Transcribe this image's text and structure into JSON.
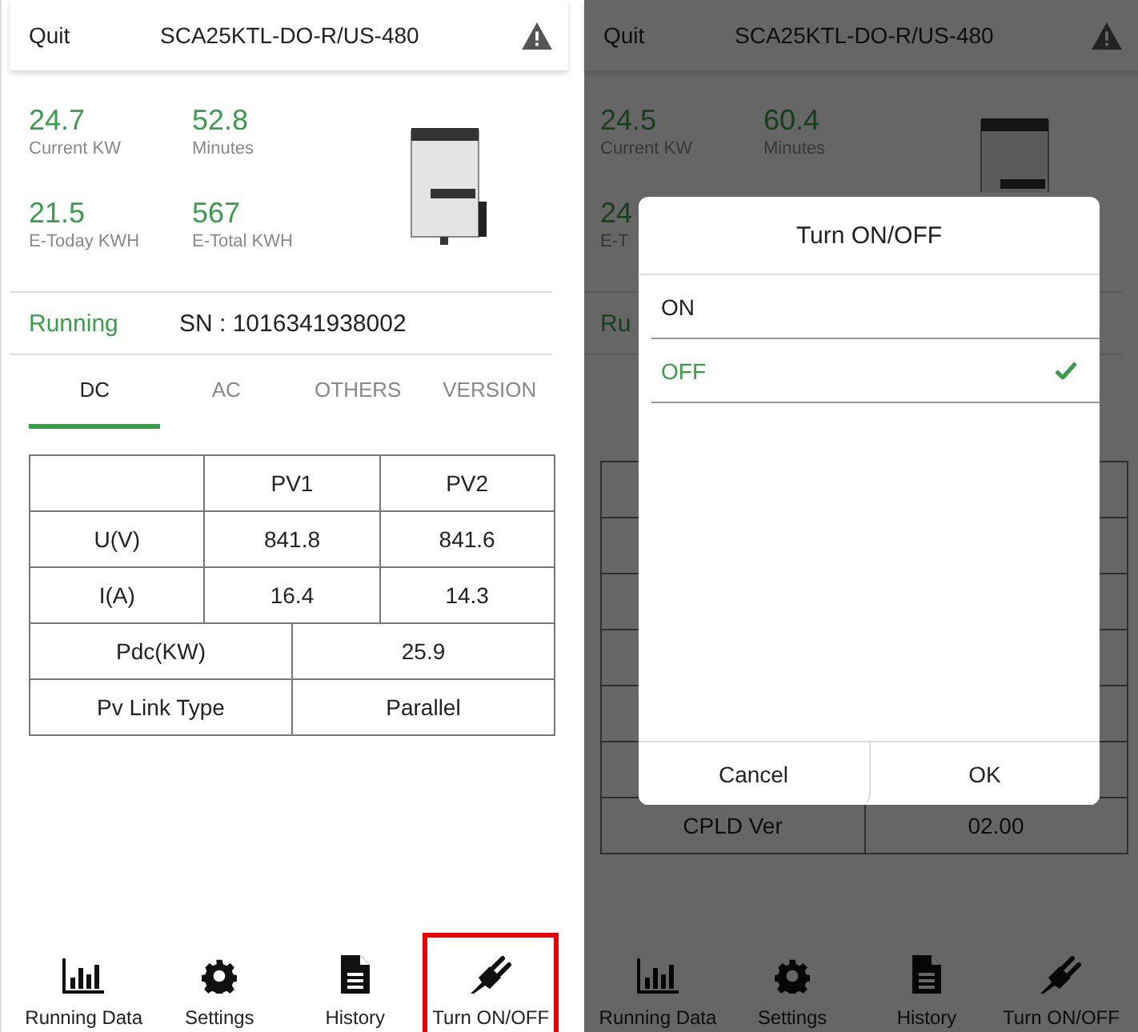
{
  "screens": [
    {
      "header": {
        "quit": "Quit",
        "title": "SCA25KTL-DO-R/US-480"
      },
      "stats": [
        {
          "value": "24.7",
          "label": "Current KW"
        },
        {
          "value": "52.8",
          "label": "Minutes"
        },
        {
          "value": "21.5",
          "label": "E-Today KWH"
        },
        {
          "value": "567",
          "label": "E-Total KWH"
        }
      ],
      "status": "Running",
      "sn": "SN : 1016341938002",
      "tabs": [
        {
          "label": "DC",
          "selected": true
        },
        {
          "label": "AC",
          "selected": false
        },
        {
          "label": "OTHERS",
          "selected": false
        },
        {
          "label": "VERSION",
          "selected": false
        }
      ],
      "table": {
        "header": [
          "PV1",
          "PV2"
        ],
        "rows": [
          {
            "cells": [
              "U(V)",
              "841.8",
              "841.6"
            ]
          },
          {
            "cells": [
              "I(A)",
              "16.4",
              "14.3"
            ]
          },
          {
            "cells": [
              "Pdc(KW)",
              "25.9"
            ]
          },
          {
            "cells": [
              "Pv Link Type",
              "Parallel"
            ]
          }
        ]
      },
      "nav": [
        {
          "kind": "chart",
          "label": "Running Data",
          "highlighted": false
        },
        {
          "kind": "gear",
          "label": "Settings",
          "highlighted": false
        },
        {
          "kind": "document",
          "label": "History",
          "highlighted": false
        },
        {
          "kind": "plug",
          "label": "Turn ON/OFF",
          "highlighted": true
        }
      ]
    },
    {
      "header": {
        "quit": "Quit",
        "title": "SCA25KTL-DO-R/US-480"
      },
      "stats": [
        {
          "value": "24.5",
          "label": "Current KW"
        },
        {
          "value": "60.4",
          "label": "Minutes"
        },
        {
          "value": "24",
          "label": "E-T"
        }
      ],
      "status": "Ru",
      "table": {
        "rows": [
          {
            "cells": [
              "CPLD Ver",
              "02.00"
            ]
          }
        ]
      },
      "nav": [
        {
          "kind": "chart",
          "label": "Running Data",
          "highlighted": false
        },
        {
          "kind": "gear",
          "label": "Settings",
          "highlighted": false
        },
        {
          "kind": "document",
          "label": "History",
          "highlighted": false
        },
        {
          "kind": "plug",
          "label": "Turn ON/OFF",
          "highlighted": false
        }
      ],
      "dialog": {
        "title": "Turn ON/OFF",
        "options": [
          {
            "label": "ON",
            "selected": false
          },
          {
            "label": "OFF",
            "selected": true
          }
        ],
        "buttons": [
          "Cancel",
          "OK"
        ]
      }
    }
  ]
}
